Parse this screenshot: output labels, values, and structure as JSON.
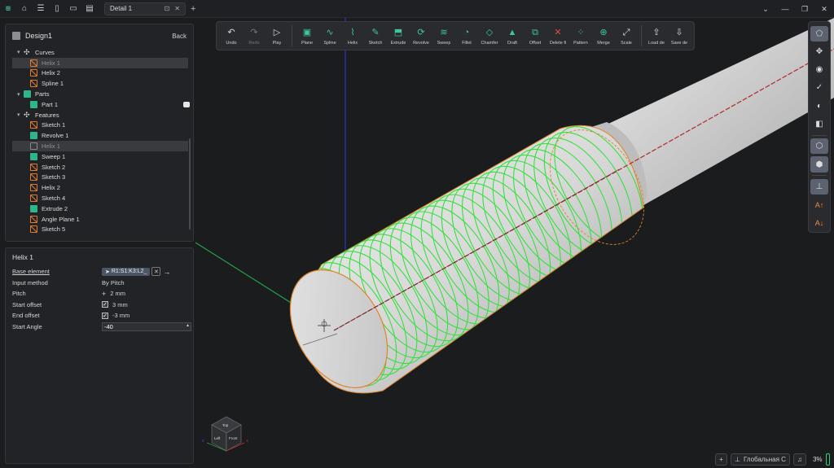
{
  "titlebar": {
    "tab_label": "Detail 1",
    "icons": [
      "logo-icon",
      "home-icon",
      "menu-icon",
      "new-file-icon",
      "open-folder-icon",
      "save-icon"
    ]
  },
  "tree": {
    "title": "Design1",
    "back_label": "Back",
    "rows": [
      {
        "label": "Curves",
        "depth": 0,
        "expander": "▾",
        "icon": "cross"
      },
      {
        "label": "Helix 1",
        "depth": 1,
        "icon": "orange",
        "selected": true
      },
      {
        "label": "Helix 2",
        "depth": 1,
        "icon": "orange"
      },
      {
        "label": "Spline 1",
        "depth": 1,
        "icon": "orange"
      },
      {
        "label": "Parts",
        "depth": 0,
        "expander": "▾",
        "icon": "green"
      },
      {
        "label": "Part 1",
        "depth": 1,
        "icon": "green",
        "badge": true
      },
      {
        "label": "Features",
        "depth": 0,
        "expander": "▾",
        "icon": "cross"
      },
      {
        "label": "Sketch 1",
        "depth": 1,
        "icon": "orange"
      },
      {
        "label": "Revolve 1",
        "depth": 1,
        "icon": "green"
      },
      {
        "label": "Helix 1",
        "depth": 1,
        "icon": "gray",
        "selected": true
      },
      {
        "label": "Sweep 1",
        "depth": 1,
        "icon": "green"
      },
      {
        "label": "Sketch 2",
        "depth": 1,
        "icon": "orange"
      },
      {
        "label": "Sketch 3",
        "depth": 1,
        "icon": "orange"
      },
      {
        "label": "Helix 2",
        "depth": 1,
        "icon": "orange"
      },
      {
        "label": "Sketch 4",
        "depth": 1,
        "icon": "orange"
      },
      {
        "label": "Extrude 2",
        "depth": 1,
        "icon": "green"
      },
      {
        "label": "Angle Plane 1",
        "depth": 1,
        "icon": "orange"
      },
      {
        "label": "Sketch 5",
        "depth": 1,
        "icon": "orange"
      }
    ]
  },
  "props": {
    "title": "Helix 1",
    "base_element_label": "Base element",
    "base_element_value": "R1:S1:K3:L2_",
    "input_method_label": "Input method",
    "input_method_value": "By Pitch",
    "pitch_label": "Pitch",
    "pitch_value": "2 mm",
    "start_offset_label": "Start offset",
    "start_offset_value": "3 mm",
    "end_offset_label": "End offset",
    "end_offset_value": "-3 mm",
    "start_angle_label": "Start Angle",
    "start_angle_value": "-40"
  },
  "toolbar": {
    "tools": [
      {
        "label": "Undo",
        "glyph": "↶",
        "style": ""
      },
      {
        "label": "Redo",
        "glyph": "↷",
        "style": "dim"
      },
      {
        "label": "Play",
        "glyph": "▷",
        "style": ""
      },
      {
        "sep": true
      },
      {
        "label": "Plane",
        "glyph": "▣",
        "style": "green"
      },
      {
        "label": "Spline",
        "glyph": "∿",
        "style": "green"
      },
      {
        "label": "Helix",
        "glyph": "⌇",
        "style": "green"
      },
      {
        "label": "Sketch",
        "glyph": "✎",
        "style": "green"
      },
      {
        "label": "Extrude",
        "glyph": "⬒",
        "style": "green"
      },
      {
        "label": "Revolve",
        "glyph": "⟳",
        "style": "green"
      },
      {
        "label": "Sweep",
        "glyph": "≋",
        "style": "green"
      },
      {
        "label": "Fillet",
        "glyph": "◔",
        "style": "green"
      },
      {
        "label": "Chamfer",
        "glyph": "◇",
        "style": "green"
      },
      {
        "label": "Draft",
        "glyph": "▲",
        "style": "green"
      },
      {
        "label": "Offset",
        "glyph": "⧉",
        "style": "green"
      },
      {
        "label": "Delete fi",
        "glyph": "✕",
        "style": "red"
      },
      {
        "label": "Pattern",
        "glyph": "⁘",
        "style": "green"
      },
      {
        "label": "Merge",
        "glyph": "⊕",
        "style": "green"
      },
      {
        "label": "Scale",
        "glyph": "⤢",
        "style": ""
      },
      {
        "sep": true
      },
      {
        "label": "Load de",
        "glyph": "⇪",
        "style": ""
      },
      {
        "label": "Save de",
        "glyph": "⇩",
        "style": ""
      }
    ]
  },
  "side_tools": [
    {
      "name": "select-mode-icon",
      "glyph": "⬠",
      "active": true
    },
    {
      "name": "move-icon",
      "glyph": "✥",
      "active": false
    },
    {
      "name": "eye-plane-icon",
      "glyph": "◉",
      "active": false
    },
    {
      "name": "measure-icon",
      "glyph": "✓",
      "active": false
    },
    {
      "name": "visibility-icon",
      "glyph": "◐",
      "active": false
    },
    {
      "name": "section-icon",
      "glyph": "◧",
      "active": false
    },
    {
      "sep": true
    },
    {
      "name": "view-cube-icon",
      "glyph": "⬡",
      "active": true
    },
    {
      "name": "ortho-icon",
      "glyph": "⬢",
      "active": true
    },
    {
      "sep": true
    },
    {
      "name": "dimension-icon",
      "glyph": "⊥",
      "active": true
    },
    {
      "name": "font-up-icon",
      "glyph": "A↑",
      "active": false,
      "orange": true
    },
    {
      "name": "font-down-icon",
      "glyph": "A↓",
      "active": false,
      "orange": true
    }
  ],
  "viewcube": {
    "top": "Top",
    "left": "Left",
    "front": "Front",
    "x": "X",
    "z": "Z"
  },
  "status": {
    "coordinate_system": "Глобальная С",
    "zoom": "3%"
  },
  "colors": {
    "helix": "#36e03e",
    "edge": "#e0842a",
    "axis_red": "#b02a2a",
    "axis_blue": "#2a36c0",
    "axis_green": "#22a34a"
  }
}
